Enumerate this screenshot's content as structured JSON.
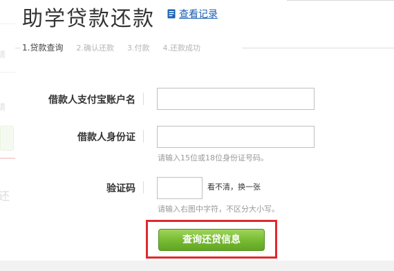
{
  "header": {
    "title": "助学贷款还款",
    "record_link": "查看记录",
    "record_icon": "document-icon",
    "link_color": "#1a5fb4"
  },
  "steps": [
    {
      "label": "1.贷款查询",
      "active": true
    },
    {
      "label": "2.确认还款",
      "active": false
    },
    {
      "label": "3.付款",
      "active": false
    },
    {
      "label": "4.还款成功",
      "active": false
    }
  ],
  "form": {
    "alipay_label": "借款人支付宝账户名",
    "alipay_value": "",
    "id_label": "借款人身份证",
    "id_value": "",
    "id_hint": "请输入15位或18位身份证号码。",
    "captcha_label": "验证码",
    "captcha_value": "",
    "captcha_refresh": "看不清，换一张",
    "captcha_hint": "请输入右图中字符，不区分大小写。"
  },
  "submit": {
    "label": "查询还贷信息",
    "color": "#78bc34",
    "highlight_color": "#e0282a"
  },
  "background_fragments": {
    "frag1": "请",
    "frag2": "请",
    "frag3": "还"
  }
}
